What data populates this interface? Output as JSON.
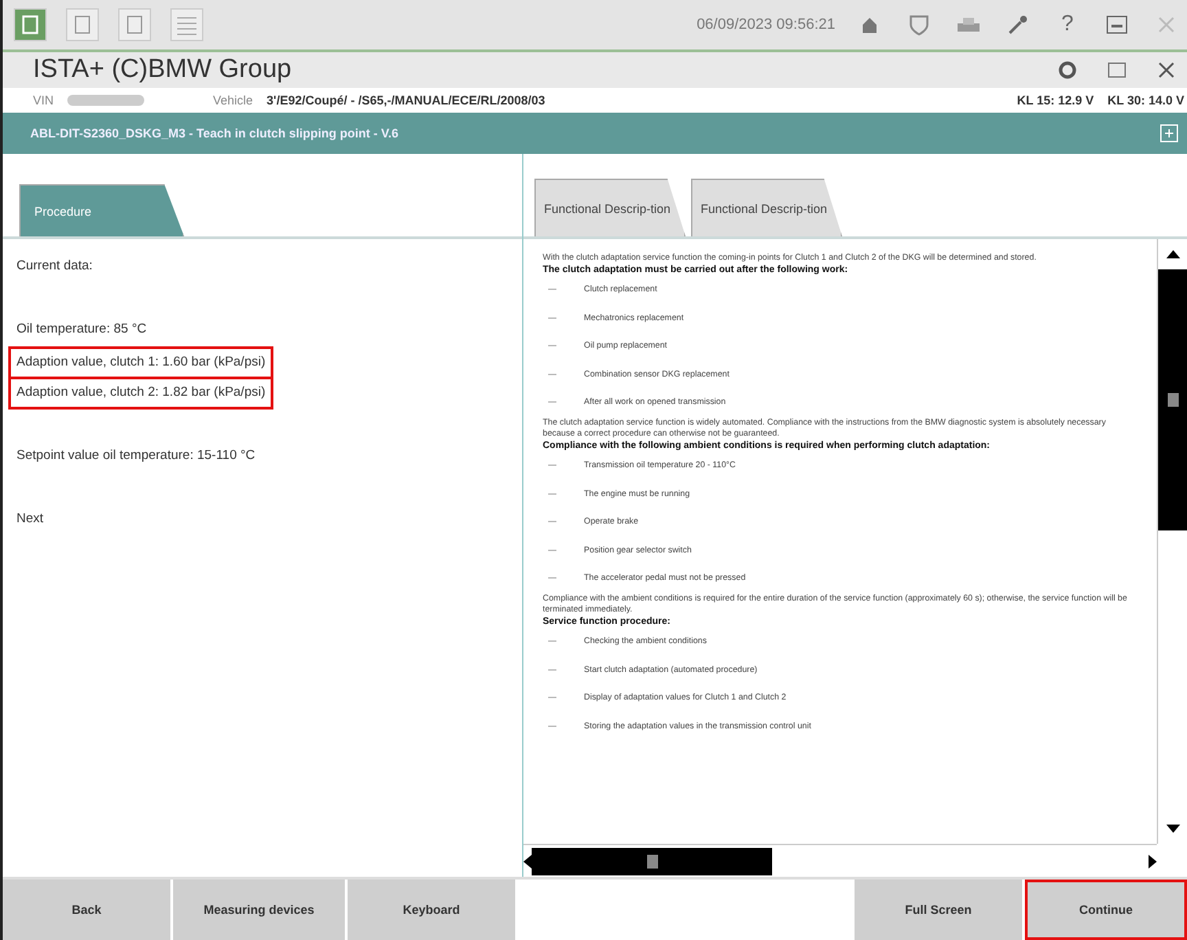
{
  "toolbar": {
    "datetime": "06/09/2023 09:56:21",
    "help": "?"
  },
  "app": {
    "title": "ISTA+ (C)BMW Group"
  },
  "vehicle_bar": {
    "vin_label": "VIN",
    "vehicle_label": "Vehicle",
    "vehicle": "3'/E92/Coupé/ - /S65,-/MANUAL/ECE/RL/2008/03",
    "kl15": "KL 15:  12.9 V",
    "kl30": "KL 30:  14.0 V"
  },
  "function_title": "ABL-DIT-S2360_DSKG_M3 - Teach in clutch slipping point - V.6",
  "tabs": [
    {
      "label": "Procedure",
      "selected": true
    },
    {
      "label": "Functional Descrip-tion",
      "selected": false
    },
    {
      "label": "Functional Descrip-tion",
      "selected": false
    }
  ],
  "current_data": [
    [
      {
        "text": "Current data:",
        "highlighted": false
      }
    ],
    [
      {
        "text": "Oil temperature: 85 °C",
        "highlighted": false
      },
      {
        "text": "Adaption value, clutch 1: 1.60 bar (kPa/psi)",
        "highlighted": true
      },
      {
        "text": "Adaption value, clutch 2: 1.82 bar (kPa/psi)",
        "highlighted": true
      }
    ],
    [
      {
        "text": "Setpoint value oil temperature: 15-110 °C",
        "highlighted": false
      }
    ],
    [
      {
        "text": "Next",
        "highlighted": false
      }
    ]
  ],
  "description": [
    {
      "kind": "para",
      "text": "With the clutch adaptation service function the coming-in points for Clutch 1 and Clutch 2 of the DKG will be determined and stored."
    },
    {
      "kind": "heading",
      "text": "The clutch adaptation must be carried out after the following work:"
    },
    {
      "kind": "bullet",
      "text": "Clutch replacement"
    },
    {
      "kind": "bullet",
      "text": "Mechatronics replacement"
    },
    {
      "kind": "bullet",
      "text": "Oil pump replacement"
    },
    {
      "kind": "bullet",
      "text": "Combination sensor DKG replacement"
    },
    {
      "kind": "bullet",
      "text": "After all work on opened transmission"
    },
    {
      "kind": "para",
      "text": "The clutch adaptation service function is widely automated. Compliance with the instructions from the BMW diagnostic system is absolutely necessary because a correct procedure can otherwise not be guaranteed."
    },
    {
      "kind": "heading",
      "text": "Compliance with the following ambient conditions is required when performing clutch adaptation:"
    },
    {
      "kind": "bullet",
      "text": "Transmission oil temperature 20 - 110°C"
    },
    {
      "kind": "bullet",
      "text": "The engine must be running"
    },
    {
      "kind": "bullet",
      "text": "Operate brake"
    },
    {
      "kind": "bullet",
      "text": "Position gear selector switch"
    },
    {
      "kind": "bullet",
      "text": "The accelerator pedal must not be pressed"
    },
    {
      "kind": "para",
      "text": "Compliance with the ambient conditions is required for the entire duration of the service function (approximately 60 s); otherwise, the service function will be terminated immediately."
    },
    {
      "kind": "heading",
      "text": "Service function procedure:"
    },
    {
      "kind": "bullet",
      "text": "Checking the ambient conditions"
    },
    {
      "kind": "bullet",
      "text": "Start clutch adaptation (automated procedure)"
    },
    {
      "kind": "bullet",
      "text": "Display of adaptation values for Clutch 1 and Clutch 2"
    },
    {
      "kind": "bullet",
      "text": "Storing the adaptation values in the transmission control unit"
    }
  ],
  "buttons_left": [
    {
      "label": "Back",
      "highlighted": false
    },
    {
      "label": "Measuring devices",
      "highlighted": false
    },
    {
      "label": "Keyboard",
      "highlighted": false
    }
  ],
  "buttons_right": [
    {
      "label": "Full Screen",
      "highlighted": false
    },
    {
      "label": "Continue",
      "highlighted": true
    }
  ]
}
